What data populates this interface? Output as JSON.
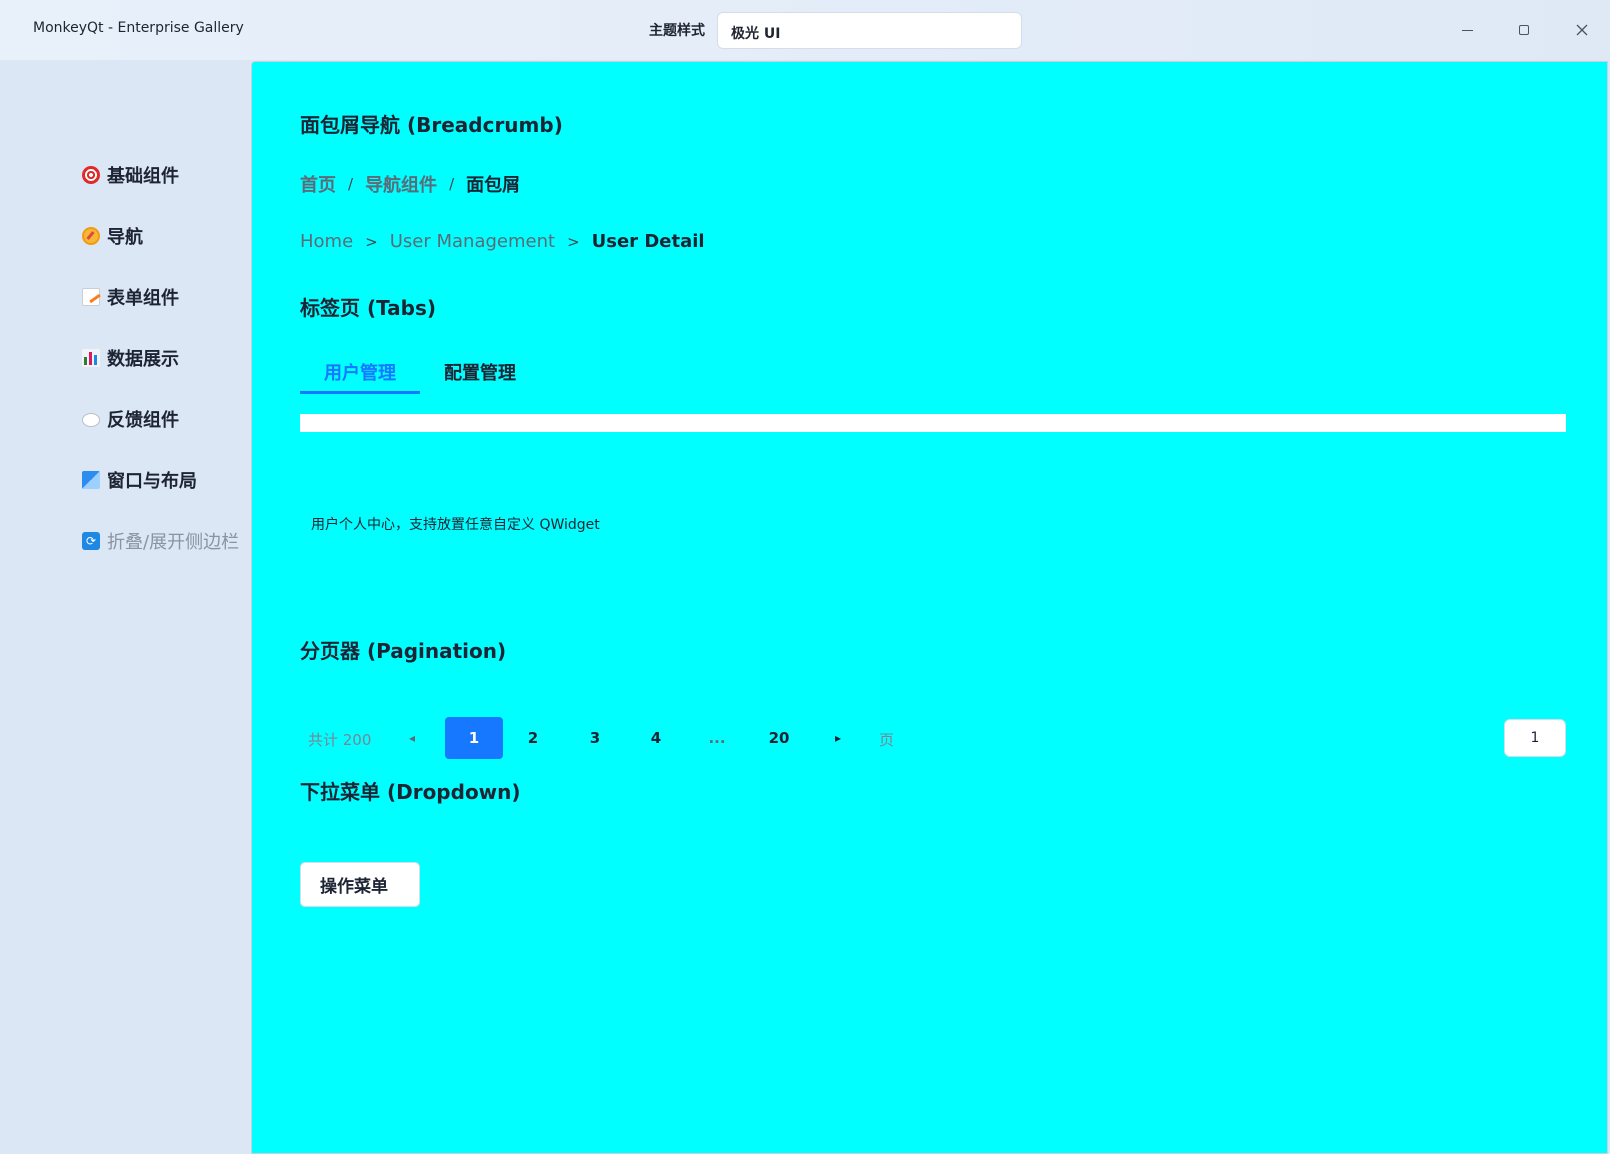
{
  "window": {
    "title": "MonkeyQt - Enterprise Gallery",
    "theme_label": "主题样式",
    "theme_value": "极光 UI"
  },
  "sidebar": {
    "items": [
      {
        "label": "基础组件",
        "icon": "target-icon"
      },
      {
        "label": "导航",
        "icon": "compass-icon"
      },
      {
        "label": "表单组件",
        "icon": "memo-icon"
      },
      {
        "label": "数据展示",
        "icon": "bar-chart-icon"
      },
      {
        "label": "反馈组件",
        "icon": "speech-bubble-icon"
      },
      {
        "label": "窗口与布局",
        "icon": "window-icon"
      },
      {
        "label": "折叠/展开侧边栏",
        "icon": "refresh-icon"
      }
    ]
  },
  "main": {
    "breadcrumb_section": {
      "title": "面包屑导航 (Breadcrumb)",
      "crumbs_cn": [
        "首页",
        "导航组件",
        "面包屑"
      ],
      "sep_cn": "/",
      "crumbs_en": [
        "Home",
        "User Management",
        "User Detail"
      ],
      "sep_en": ">"
    },
    "tabs_section": {
      "title": "标签页 (Tabs)",
      "tabs": [
        "用户管理",
        "配置管理"
      ],
      "active_tab": "用户管理",
      "content": "用户个人中心，支持放置任意自定义 QWidget"
    },
    "pagination_section": {
      "title": "分页器 (Pagination)",
      "total": "共计 200",
      "prev": "◂",
      "pages": [
        "1",
        "2",
        "3",
        "4",
        "...",
        "20"
      ],
      "current_page": "1",
      "next": "▸",
      "page_label": "页",
      "jump_value": "1"
    },
    "dropdown_section": {
      "title": "下拉菜单 (Dropdown)",
      "button_label": "操作菜单"
    }
  },
  "colors": {
    "main_bg": "#00ffff",
    "sidebar_bg": "#dbe7f4",
    "accent": "#1677ff"
  }
}
